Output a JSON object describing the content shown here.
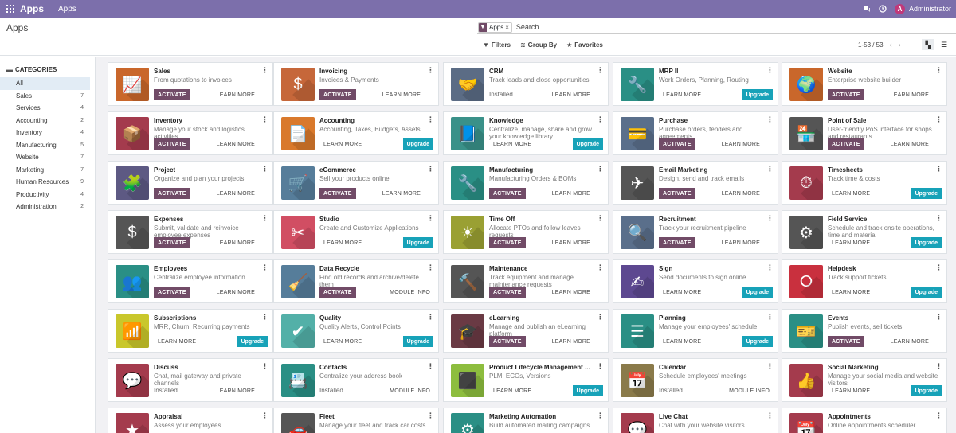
{
  "topbar": {
    "brand": "Apps",
    "menu": "Apps",
    "user": "Administrator",
    "avatar_letter": "A"
  },
  "control_panel": {
    "title": "Apps",
    "facet": "Apps",
    "search_placeholder": "Search...",
    "filters": "Filters",
    "group_by": "Group By",
    "favorites": "Favorites",
    "pager": "1-53 / 53"
  },
  "sidebar": {
    "heading": "CATEGORIES",
    "items": [
      {
        "label": "All",
        "count": ""
      },
      {
        "label": "Sales",
        "count": "7"
      },
      {
        "label": "Services",
        "count": "4"
      },
      {
        "label": "Accounting",
        "count": "2"
      },
      {
        "label": "Inventory",
        "count": "4"
      },
      {
        "label": "Manufacturing",
        "count": "5"
      },
      {
        "label": "Website",
        "count": "7"
      },
      {
        "label": "Marketing",
        "count": "7"
      },
      {
        "label": "Human Resources",
        "count": "9"
      },
      {
        "label": "Productivity",
        "count": "4"
      },
      {
        "label": "Administration",
        "count": "2"
      }
    ]
  },
  "labels": {
    "activate": "ACTIVATE",
    "learn_more": "LEARN MORE",
    "upgrade": "Upgrade",
    "installed": "Installed",
    "module_info": "MODULE INFO"
  },
  "apps": [
    {
      "name": "Sales",
      "desc": "From quotations to invoices",
      "state": "activate",
      "color": "#c9672b",
      "icon": "chart-icon",
      "glyph": "📈"
    },
    {
      "name": "Invoicing",
      "desc": "Invoices & Payments",
      "state": "activate",
      "color": "#c6673a",
      "icon": "invoice-icon",
      "glyph": "$"
    },
    {
      "name": "CRM",
      "desc": "Track leads and close opportunities",
      "state": "installed_learn",
      "color": "#5b6c85",
      "icon": "handshake-icon",
      "glyph": "🤝"
    },
    {
      "name": "MRP II",
      "desc": "Work Orders, Planning, Routing",
      "state": "upgrade",
      "color": "#2a8f85",
      "icon": "wrench-icon",
      "glyph": "🔧"
    },
    {
      "name": "Website",
      "desc": "Enterprise website builder",
      "state": "activate",
      "color": "#c9672b",
      "icon": "globe-icon",
      "glyph": "🌍"
    },
    {
      "name": "Inventory",
      "desc": "Manage your stock and logistics activities",
      "state": "activate",
      "color": "#a43b4d",
      "icon": "box-icon",
      "glyph": "📦"
    },
    {
      "name": "Accounting",
      "desc": "Accounting, Taxes, Budgets, Assets...",
      "state": "upgrade",
      "color": "#d9792c",
      "icon": "document-icon",
      "glyph": "📄"
    },
    {
      "name": "Knowledge",
      "desc": "Centralize, manage, share and grow your knowledge library",
      "state": "upgrade",
      "color": "#3a9189",
      "icon": "book-icon",
      "glyph": "📘"
    },
    {
      "name": "Purchase",
      "desc": "Purchase orders, tenders and agreements",
      "state": "activate",
      "color": "#5a6f8b",
      "icon": "card-icon",
      "glyph": "💳"
    },
    {
      "name": "Point of Sale",
      "desc": "User-friendly PoS interface for shops and restaurants",
      "state": "activate",
      "color": "#555555",
      "icon": "shop-icon",
      "glyph": "🏪"
    },
    {
      "name": "Project",
      "desc": "Organize and plan your projects",
      "state": "activate",
      "color": "#5d5983",
      "icon": "puzzle-icon",
      "glyph": "🧩"
    },
    {
      "name": "eCommerce",
      "desc": "Sell your products online",
      "state": "activate",
      "color": "#567d9a",
      "icon": "cart-icon",
      "glyph": "🛒"
    },
    {
      "name": "Manufacturing",
      "desc": "Manufacturing Orders & BOMs",
      "state": "activate",
      "color": "#2a8f85",
      "icon": "tools-icon",
      "glyph": "🔧"
    },
    {
      "name": "Email Marketing",
      "desc": "Design, send and track emails",
      "state": "activate",
      "color": "#555555",
      "icon": "paper-plane-icon",
      "glyph": "✈"
    },
    {
      "name": "Timesheets",
      "desc": "Track time & costs",
      "state": "upgrade",
      "color": "#a43b4d",
      "icon": "stopwatch-icon",
      "glyph": "⏱"
    },
    {
      "name": "Expenses",
      "desc": "Submit, validate and reinvoice employee expenses",
      "state": "activate",
      "color": "#555555",
      "icon": "money-icon",
      "glyph": "$"
    },
    {
      "name": "Studio",
      "desc": "Create and Customize Applications",
      "state": "upgrade",
      "color": "#d14e63",
      "icon": "studio-icon",
      "glyph": "✂"
    },
    {
      "name": "Time Off",
      "desc": "Allocate PTOs and follow leaves requests",
      "state": "activate",
      "color": "#9aa033",
      "icon": "sun-user-icon",
      "glyph": "☀"
    },
    {
      "name": "Recruitment",
      "desc": "Track your recruitment pipeline",
      "state": "activate",
      "color": "#5a6f8b",
      "icon": "magnifier-icon",
      "glyph": "🔍"
    },
    {
      "name": "Field Service",
      "desc": "Schedule and track onsite operations, time and material",
      "state": "upgrade",
      "color": "#555555",
      "icon": "field-service-icon",
      "glyph": "⚙"
    },
    {
      "name": "Employees",
      "desc": "Centralize employee information",
      "state": "activate",
      "color": "#2a8f85",
      "icon": "people-icon",
      "glyph": "👥"
    },
    {
      "name": "Data Recycle",
      "desc": "Find old records and archive/delete them",
      "state": "activate_info",
      "color": "#567d9a",
      "icon": "broom-icon",
      "glyph": "🧹"
    },
    {
      "name": "Maintenance",
      "desc": "Track equipment and manage maintenance requests",
      "state": "activate",
      "color": "#555555",
      "icon": "hammer-icon",
      "glyph": "🔨"
    },
    {
      "name": "Sign",
      "desc": "Send documents to sign online",
      "state": "upgrade",
      "color": "#5d4890",
      "icon": "sign-icon",
      "glyph": "✍"
    },
    {
      "name": "Helpdesk",
      "desc": "Track support tickets",
      "state": "upgrade",
      "color": "#c9303e",
      "icon": "lifebuoy-icon",
      "glyph": "⭘"
    },
    {
      "name": "Subscriptions",
      "desc": "MRR, Churn, Recurring payments",
      "state": "upgrade",
      "color": "#c9c72b",
      "icon": "rss-icon",
      "glyph": "📶"
    },
    {
      "name": "Quality",
      "desc": "Quality Alerts, Control Points",
      "state": "upgrade",
      "color": "#53b0a8",
      "icon": "clipboard-icon",
      "glyph": "✔"
    },
    {
      "name": "eLearning",
      "desc": "Manage and publish an eLearning platform",
      "state": "activate",
      "color": "#6a3a44",
      "icon": "elearning-icon",
      "glyph": "🎓"
    },
    {
      "name": "Planning",
      "desc": "Manage your employees' schedule",
      "state": "upgrade",
      "color": "#2a8f85",
      "icon": "planning-icon",
      "glyph": "☰"
    },
    {
      "name": "Events",
      "desc": "Publish events, sell tickets",
      "state": "activate",
      "color": "#2a8f85",
      "icon": "ticket-icon",
      "glyph": "🎫"
    },
    {
      "name": "Discuss",
      "desc": "Chat, mail gateway and private channels",
      "state": "installed_learn",
      "color": "#a43b4d",
      "icon": "chat-icon",
      "glyph": "💬"
    },
    {
      "name": "Contacts",
      "desc": "Centralize your address book",
      "state": "installed_info",
      "color": "#2a8f85",
      "icon": "contacts-icon",
      "glyph": "📇"
    },
    {
      "name": "Product Lifecycle Management ...",
      "desc": "PLM, ECOs, Versions",
      "state": "upgrade",
      "color": "#8dbd3e",
      "icon": "cube-icon",
      "glyph": "⬛"
    },
    {
      "name": "Calendar",
      "desc": "Schedule employees' meetings",
      "state": "installed_info",
      "color": "#8a7a4a",
      "icon": "calendar-icon",
      "glyph": "📅"
    },
    {
      "name": "Social Marketing",
      "desc": "Manage your social media and website visitors",
      "state": "upgrade",
      "color": "#a43b4d",
      "icon": "thumbs-up-icon",
      "glyph": "👍"
    },
    {
      "name": "Appraisal",
      "desc": "Assess your employees",
      "state": "none",
      "color": "#a43b4d",
      "icon": "star-icon",
      "glyph": "★"
    },
    {
      "name": "Fleet",
      "desc": "Manage your fleet and track car costs",
      "state": "none",
      "color": "#555555",
      "icon": "car-icon",
      "glyph": "🚗"
    },
    {
      "name": "Marketing Automation",
      "desc": "Build automated mailing campaigns",
      "state": "none",
      "color": "#2a8f85",
      "icon": "gears-icon",
      "glyph": "⚙"
    },
    {
      "name": "Live Chat",
      "desc": "Chat with your website visitors",
      "state": "none",
      "color": "#a43b4d",
      "icon": "live-chat-icon",
      "glyph": "💬"
    },
    {
      "name": "Appointments",
      "desc": "Online appointments scheduler",
      "state": "none",
      "color": "#a43b4d",
      "icon": "appointments-icon",
      "glyph": "📆"
    }
  ]
}
